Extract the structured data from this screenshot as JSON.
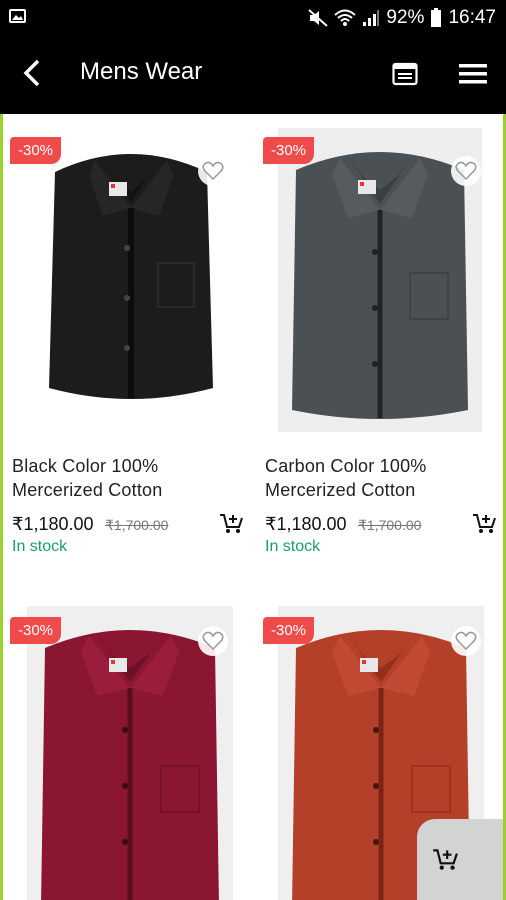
{
  "status_bar": {
    "battery": "92%",
    "time": "16:47"
  },
  "header": {
    "title": "Mens Wear"
  },
  "products": [
    {
      "discount": "-30%",
      "name": "Black Color 100% Mercerized  Cotton",
      "price": "₹1,180.00",
      "mrp": "₹1,700.00",
      "stock": "In stock",
      "color": "#1c1c1c"
    },
    {
      "discount": "-30%",
      "name": "Carbon Color 100% Mercerized Cotton",
      "price": "₹1,180.00",
      "mrp": "₹1,700.00",
      "stock": "In stock",
      "color": "#4a5054"
    },
    {
      "discount": "-30%",
      "color": "#8a1632"
    },
    {
      "discount": "-30%",
      "color": "#b4402a"
    }
  ]
}
